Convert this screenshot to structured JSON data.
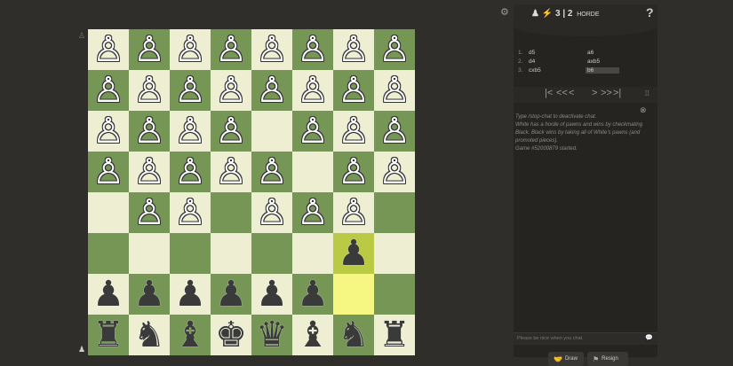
{
  "board": {
    "light_color": "#eeeed2",
    "dark_color": "#769656",
    "highlight_squares": [
      "g3",
      "g2"
    ],
    "ranks": [
      [
        "P",
        "P",
        "P",
        "P",
        "P",
        "P",
        "P",
        "P"
      ],
      [
        "P",
        "P",
        "P",
        "P",
        "P",
        "P",
        "P",
        "P"
      ],
      [
        "P",
        "P",
        "P",
        "P",
        "",
        "P",
        "P",
        "P"
      ],
      [
        "P",
        "P",
        "P",
        "P",
        "P",
        "",
        "P",
        "P"
      ],
      [
        "",
        "P",
        "P",
        "",
        "P",
        "P",
        "P",
        ""
      ],
      [
        "",
        "",
        "",
        "",
        "",
        "",
        "p",
        ""
      ],
      [
        "p",
        "p",
        "p",
        "p",
        "p",
        "p",
        "",
        ""
      ],
      [
        "r",
        "n",
        "b",
        "k",
        "q",
        "b",
        "n",
        "r"
      ]
    ],
    "glyphs": {
      "P": "♙",
      "p": "♟",
      "r": "♜",
      "n": "♞",
      "b": "♝",
      "k": "♚",
      "q": "♛"
    },
    "top_player_icon": "pawn-icon",
    "bottom_player_icon": "pawn-icon"
  },
  "header": {
    "time_control": "3 | 2",
    "variant": "HORDE",
    "help_label": "?"
  },
  "moves": [
    {
      "num": "1.",
      "white": "d5",
      "black": "a6"
    },
    {
      "num": "2.",
      "white": "d4",
      "black": "axb5"
    },
    {
      "num": "3.",
      "white": "cxb5",
      "black": "b6"
    }
  ],
  "nav": {
    "first": "|<",
    "prev_all": "<<",
    "prev": "<",
    "next": ">",
    "next_all": ">>",
    "last": ">|"
  },
  "chat": {
    "messages": [
      "Type /stop-chat to deactivate chat.",
      "White has a horde of pawns and wins by checkmating Black. Black wins by taking all of White's pawns (and promoted pieces).",
      "Game #52000879 started."
    ],
    "placeholder": "Please be nice when you chat."
  },
  "buttons": {
    "draw": "Draw",
    "resign": "Resign"
  }
}
